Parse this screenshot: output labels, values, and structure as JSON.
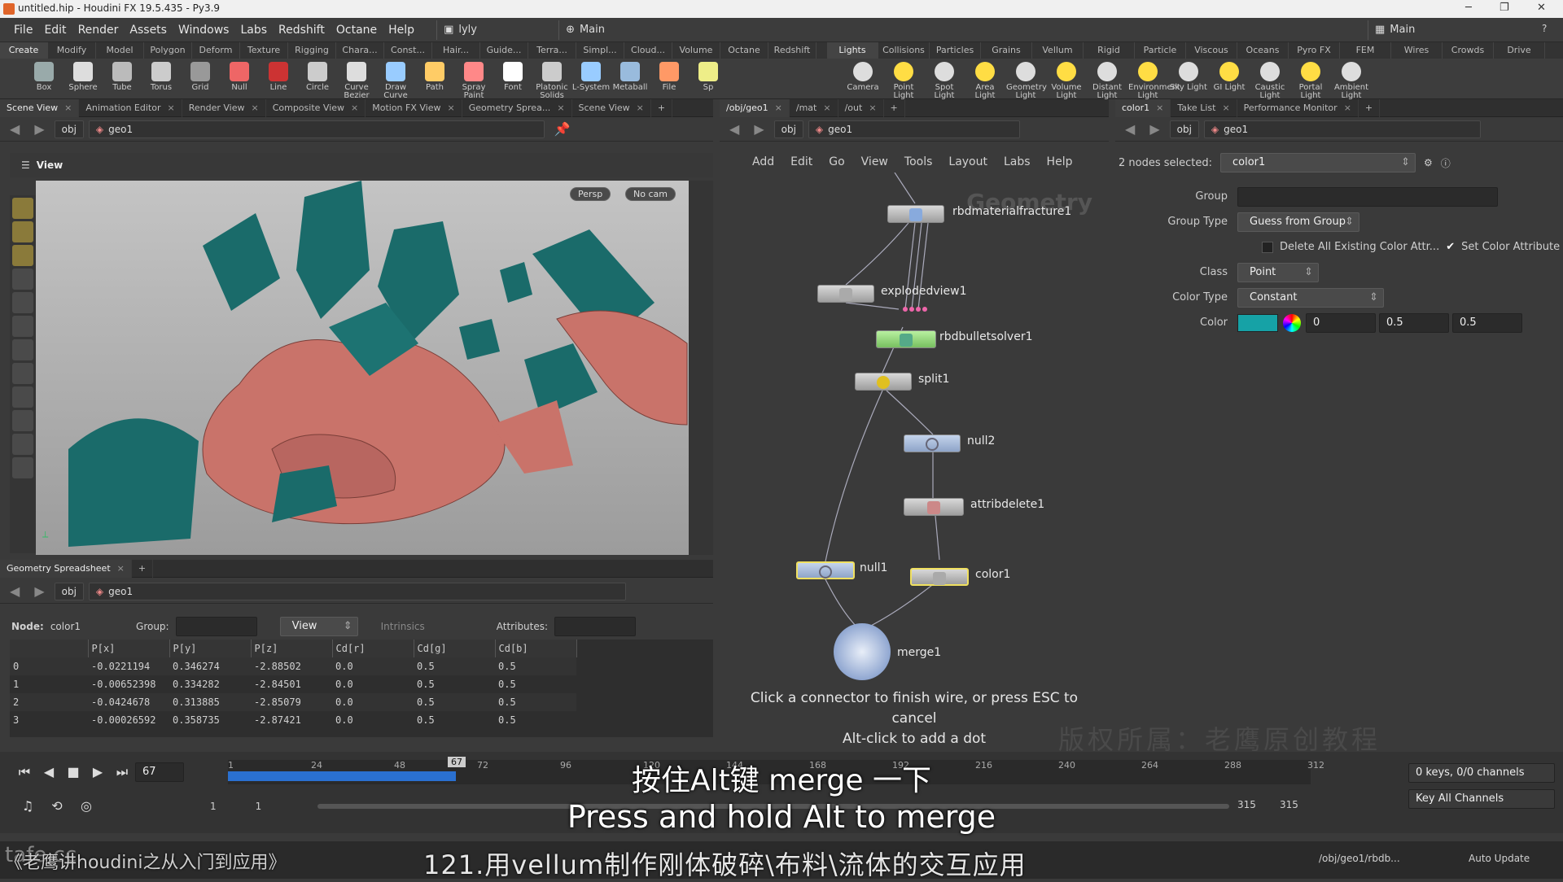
{
  "window": {
    "title": "untitled.hip - Houdini FX 19.5.435 - Py3.9"
  },
  "menu": {
    "items": [
      "File",
      "Edit",
      "Render",
      "Assets",
      "Windows",
      "Labs",
      "Redshift",
      "Octane",
      "Help"
    ],
    "desktop": "lyly",
    "main": "Main",
    "main_right": "Main"
  },
  "shelf_tabs_left": [
    "Create",
    "Modify",
    "Model",
    "Polygon",
    "Deform",
    "Texture",
    "Rigging",
    "Chara...",
    "Const...",
    "Hair...",
    "Guide...",
    "Terra...",
    "Simpl...",
    "Cloud...",
    "Volume",
    "Octane",
    "Redshift"
  ],
  "shelf_tabs_right": [
    "Lights and...",
    "Collisions",
    "Particles",
    "Grains",
    "Vellum",
    "Rigid Bodies",
    "Particle Fl...",
    "Viscous Fl...",
    "Oceans",
    "Pyro FX",
    "FEM",
    "Wires",
    "Crowds",
    "Drive Sim..."
  ],
  "tools_left": [
    "Box",
    "Sphere",
    "Tube",
    "Torus",
    "Grid",
    "Null",
    "Line",
    "Circle",
    "Curve Bezier",
    "Draw Curve",
    "Path",
    "Spray Paint",
    "Font",
    "Platonic Solids",
    "L-System",
    "Metaball",
    "File",
    "Sp"
  ],
  "tools_right": [
    "Camera",
    "Point Light",
    "Spot Light",
    "Area Light",
    "Geometry Light",
    "Volume Light",
    "Distant Light",
    "Environment Light",
    "Sky Light",
    "GI Light",
    "Caustic Light",
    "Portal Light",
    "Ambient Light"
  ],
  "viewer_tabs": [
    "Scene View",
    "Animation Editor",
    "Render View",
    "Composite View",
    "Motion FX View",
    "Geometry Sprea...",
    "Scene View"
  ],
  "net_tabs": [
    "/obj/geo1",
    "/mat",
    "/out"
  ],
  "parm_tabs": [
    "color1",
    "Take List",
    "Performance Monitor"
  ],
  "path": {
    "obj": "obj",
    "geo": "geo1"
  },
  "viewport": {
    "label": "View",
    "persp": "Persp",
    "cam": "No cam"
  },
  "spreadsheet": {
    "tab": "Geometry Spreadsheet",
    "node_label": "Node:",
    "node": "color1",
    "group_label": "Group:",
    "view": "View",
    "intrinsics": "Intrinsics",
    "attributes": "Attributes:",
    "columns": [
      "",
      "P[x]",
      "P[y]",
      "P[z]",
      "Cd[r]",
      "Cd[g]",
      "Cd[b]"
    ],
    "rows": [
      [
        "0",
        "-0.0221194",
        "0.346274",
        "-2.88502",
        "0.0",
        "0.5",
        "0.5"
      ],
      [
        "1",
        "-0.00652398",
        "0.334282",
        "-2.84501",
        "0.0",
        "0.5",
        "0.5"
      ],
      [
        "2",
        "-0.0424678",
        "0.313885",
        "-2.85079",
        "0.0",
        "0.5",
        "0.5"
      ],
      [
        "3",
        "-0.00026592",
        "0.358735",
        "-2.87421",
        "0.0",
        "0.5",
        "0.5"
      ]
    ]
  },
  "network": {
    "menu": [
      "Add",
      "Edit",
      "Go",
      "View",
      "Tools",
      "Layout",
      "Labs",
      "Help"
    ],
    "watermark": "Geometry",
    "nodes": [
      "rbdmaterialfracture1",
      "explodedview1",
      "rbdbulletsolver1",
      "split1",
      "null2",
      "attribdelete1",
      "null1",
      "color1",
      "merge1"
    ],
    "hint": [
      "Click a connector to finish wire, or press ESC to",
      "cancel",
      "Alt-click to add a dot"
    ]
  },
  "params": {
    "selected": "2 nodes selected:",
    "node": "color1",
    "group": "Group",
    "group_type_label": "Group Type",
    "group_type": "Guess from Group",
    "delete_all": "Delete All Existing Color Attr...",
    "set_color": "Set Color Attribute",
    "class_label": "Class",
    "class": "Point",
    "color_type_label": "Color Type",
    "color_type": "Constant",
    "color_label": "Color",
    "color_r": "0",
    "color_g": "0.5",
    "color_b": "0.5",
    "swatch": "#16a2a6"
  },
  "timeline": {
    "frame": "67",
    "ticks": [
      "1",
      "24",
      "48",
      "72",
      "96",
      "120",
      "144",
      "168",
      "192",
      "216",
      "240",
      "264",
      "288",
      "312"
    ],
    "cursor": "67",
    "start": "1",
    "start2": "1",
    "end": "315",
    "end2": "315",
    "keys": "0 keys, 0/0 channels",
    "key_all": "Key All Channels",
    "auto": "Auto Update",
    "status_path": "/obj/geo1/rbdb..."
  },
  "subtitle": {
    "zh": "按住Alt键 merge 一下",
    "en": "Press and hold Alt to merge",
    "course": "121.用vellum制作刚体破碎\\布料\\流体的交互应用",
    "series": "《老鹰讲houdini之从入门到应用》",
    "copyright": "版权所属：老鹰原创教程",
    "brand": "tafe.cc"
  }
}
